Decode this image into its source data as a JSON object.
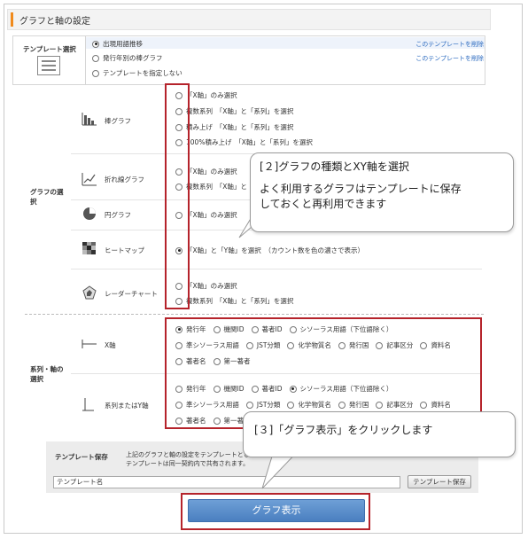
{
  "header": {
    "title": "グラフと軸の設定"
  },
  "template_select": {
    "label": "テンプレート選択",
    "options": [
      {
        "label": "出現用語推移",
        "selected": true,
        "delete_label": "このテンプレートを削除"
      },
      {
        "label": "発行年別の棒グラフ",
        "selected": false,
        "delete_label": "このテンプレートを削除"
      },
      {
        "label": "テンプレートを指定しない",
        "selected": false
      }
    ]
  },
  "graph_types": {
    "label": "グラフの選択",
    "charts": [
      {
        "name": "棒グラフ",
        "options": [
          {
            "label": "「X軸」のみ選択",
            "selected": false
          },
          {
            "label": "複数系列　「X軸」と「系列」を選択",
            "selected": false
          },
          {
            "label": "積み上げ　「X軸」と「系列」を選択",
            "selected": false
          },
          {
            "label": "100%積み上げ　「X軸」と「系列」を選択",
            "selected": false
          }
        ]
      },
      {
        "name": "折れ線グラフ",
        "options": [
          {
            "label": "「X軸」のみ選択",
            "selected": false
          },
          {
            "label": "複数系列　「X軸」と「系列」を選択",
            "selected": false
          }
        ]
      },
      {
        "name": "円グラフ",
        "options": [
          {
            "label": "「X軸」のみ選択",
            "selected": false
          }
        ]
      },
      {
        "name": "ヒートマップ",
        "options": [
          {
            "label": "「X軸」と「Y軸」を選択　（カウント数を色の濃さで表示）",
            "selected": true
          }
        ]
      },
      {
        "name": "レーダーチャート",
        "options": [
          {
            "label": "「X軸」のみ選択",
            "selected": false
          },
          {
            "label": "複数系列　「X軸」と「系列」を選択",
            "selected": false
          }
        ]
      }
    ]
  },
  "axes": {
    "label": "系列・軸の選択",
    "x_axis": {
      "name": "X軸",
      "rows": [
        [
          {
            "label": "発行年",
            "selected": true
          },
          {
            "label": "機関ID",
            "selected": false
          },
          {
            "label": "著者ID",
            "selected": false
          },
          {
            "label": "シソーラス用語（下位語除く）",
            "selected": false
          }
        ],
        [
          {
            "label": "準シソーラス用語",
            "selected": false
          },
          {
            "label": "JST分類",
            "selected": false
          },
          {
            "label": "化学物質名",
            "selected": false
          },
          {
            "label": "発行国",
            "selected": false
          },
          {
            "label": "記事区分",
            "selected": false
          },
          {
            "label": "資料名",
            "selected": false
          }
        ],
        [
          {
            "label": "著者名",
            "selected": false
          },
          {
            "label": "第一著者",
            "selected": false
          }
        ]
      ]
    },
    "y_axis": {
      "name": "系列またはY軸",
      "rows": [
        [
          {
            "label": "発行年",
            "selected": false
          },
          {
            "label": "機関ID",
            "selected": false
          },
          {
            "label": "著者ID",
            "selected": false
          },
          {
            "label": "シソーラス用語（下位語除く）",
            "selected": true
          }
        ],
        [
          {
            "label": "準シソーラス用語",
            "selected": false
          },
          {
            "label": "JST分類",
            "selected": false
          },
          {
            "label": "化学物質名",
            "selected": false
          },
          {
            "label": "発行国",
            "selected": false
          },
          {
            "label": "記事区分",
            "selected": false
          },
          {
            "label": "資料名",
            "selected": false
          }
        ],
        [
          {
            "label": "著者名",
            "selected": false
          },
          {
            "label": "第一著者",
            "selected": false
          }
        ]
      ]
    }
  },
  "callouts": {
    "c1_line1": "[２]グラフの種類とXY軸を選択",
    "c1_line2": "よく利用するグラフはテンプレートに保存",
    "c1_line3": "しておくと再利用できます",
    "c2_line1": "[３]「グラフ表示」をクリックします"
  },
  "template_save": {
    "label": "テンプレート保存",
    "note_line1": "上記のグラフと軸の設定をテンプレートとして保存します。",
    "note_line2": "テンプレートは同一契約内で共有されます。",
    "input_value": "テンプレート名",
    "button_label": "テンプレート保存"
  },
  "show_graph_button": "グラフ表示",
  "colors": {
    "accent": "#f08a1c",
    "highlight_border": "#b5232b",
    "primary_button": "#5a8ccb",
    "link": "#2e6cc0"
  }
}
